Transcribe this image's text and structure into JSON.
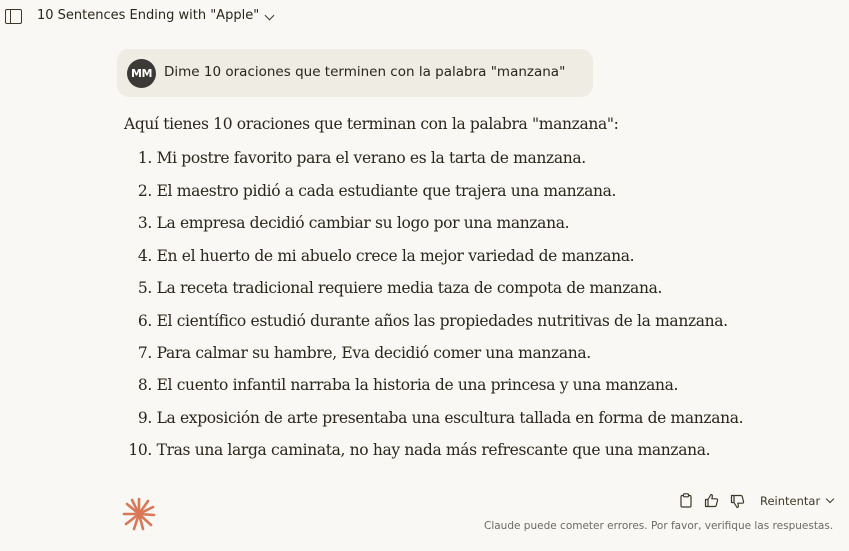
{
  "header": {
    "title": "10 Sentences Ending with \"Apple\""
  },
  "user_message": {
    "avatar_initials": "MM",
    "text": "Dime 10 oraciones que terminen con la palabra \"manzana\""
  },
  "response": {
    "intro": "Aquí tienes 10 oraciones que terminan con la palabra \"manzana\":",
    "items": [
      {
        "num": "1.",
        "text": "Mi postre favorito para el verano es la tarta de manzana."
      },
      {
        "num": "2.",
        "text": "El maestro pidió a cada estudiante que trajera una manzana."
      },
      {
        "num": "3.",
        "text": "La empresa decidió cambiar su logo por una manzana."
      },
      {
        "num": "4.",
        "text": "En el huerto de mi abuelo crece la mejor variedad de manzana."
      },
      {
        "num": "5.",
        "text": "La receta tradicional requiere media taza de compota de manzana."
      },
      {
        "num": "6.",
        "text": "El científico estudió durante años las propiedades nutritivas de la manzana."
      },
      {
        "num": "7.",
        "text": "Para calmar su hambre, Eva decidió comer una manzana."
      },
      {
        "num": "8.",
        "text": "El cuento infantil narraba la historia de una princesa y una manzana."
      },
      {
        "num": "9.",
        "text": "La exposición de arte presentaba una escultura tallada en forma de manzana."
      },
      {
        "num": "10.",
        "text": "Tras una larga caminata, no hay nada más refrescante que una manzana."
      }
    ]
  },
  "actions": {
    "retry_label": "Reintentar",
    "icons": [
      "copy-icon",
      "thumbs-up-icon",
      "thumbs-down-icon"
    ]
  },
  "footer": {
    "disclaimer": "Claude puede cometer errores. Por favor, verifique las respuestas."
  },
  "colors": {
    "background": "#f9f8f4",
    "bubble": "#efece3",
    "avatar": "#3b3a36",
    "claude_accent": "#d97757"
  }
}
